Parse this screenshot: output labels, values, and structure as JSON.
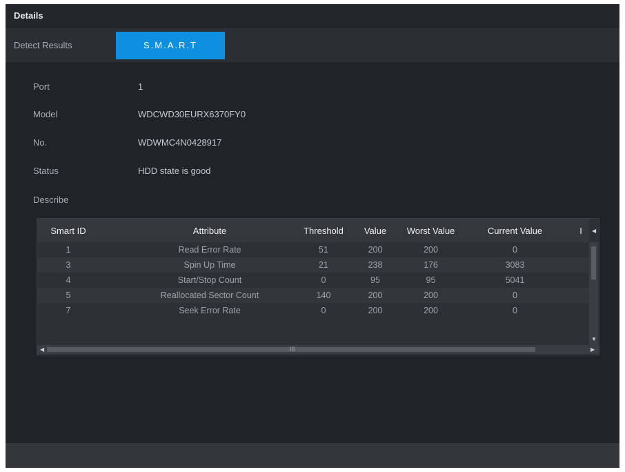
{
  "window": {
    "title": "Details"
  },
  "tabs": [
    {
      "label": "Detect Results"
    },
    {
      "label": "S.M.A.R.T"
    }
  ],
  "fields": {
    "port": {
      "label": "Port",
      "value": "1"
    },
    "model": {
      "label": "Model",
      "value": "WDCWD30EURX6370FY0"
    },
    "no": {
      "label": "No.",
      "value": "WDWMC4N0428917"
    },
    "status": {
      "label": "Status",
      "value": "HDD state is good"
    },
    "describe": {
      "label": "Describe"
    }
  },
  "table": {
    "columns": [
      "Smart ID",
      "Attribute",
      "Threshold",
      "Value",
      "Worst Value",
      "Current Value",
      "I"
    ],
    "rows": [
      [
        "1",
        "Read Error Rate",
        "51",
        "200",
        "200",
        "0"
      ],
      [
        "3",
        "Spin Up Time",
        "21",
        "238",
        "176",
        "3083"
      ],
      [
        "4",
        "Start/Stop Count",
        "0",
        "95",
        "95",
        "5041"
      ],
      [
        "5",
        "Reallocated Sector Count",
        "140",
        "200",
        "200",
        "0"
      ],
      [
        "7",
        "Seek Error Rate",
        "0",
        "200",
        "200",
        "0"
      ]
    ],
    "hscroll_label": "III"
  },
  "icons": {
    "scroll_up": "triangle-up",
    "scroll_down": "triangle-down",
    "scroll_left": "triangle-left",
    "scroll_right": "triangle-right"
  },
  "colors": {
    "accent": "#0f8fe0",
    "background": "#202327",
    "titlebar": "#23262b"
  }
}
